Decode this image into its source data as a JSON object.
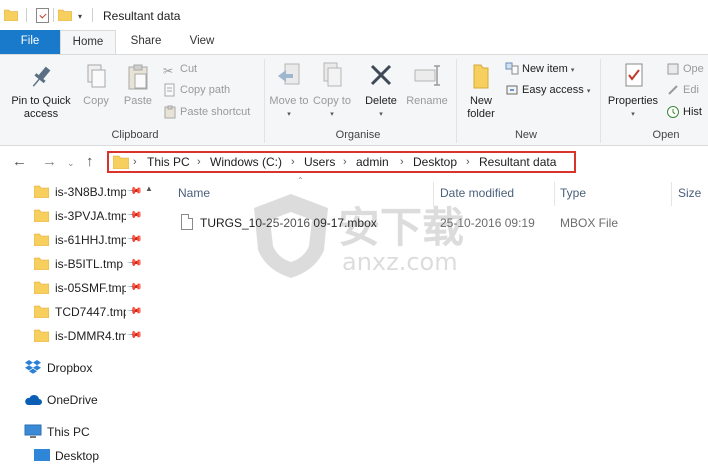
{
  "window": {
    "title": "Resultant data"
  },
  "ribbon_tabs": [
    {
      "label": "File"
    },
    {
      "label": "Home"
    },
    {
      "label": "Share"
    },
    {
      "label": "View"
    }
  ],
  "ribbon": {
    "clipboard": {
      "label": "Clipboard",
      "pin_to_quick_access": "Pin to Quick access",
      "copy": "Copy",
      "paste": "Paste",
      "cut": "Cut",
      "copy_path": "Copy path",
      "paste_shortcut": "Paste shortcut"
    },
    "organise": {
      "label": "Organise",
      "move_to": "Move to",
      "copy_to": "Copy to",
      "delete": "Delete",
      "rename": "Rename"
    },
    "new": {
      "label": "New",
      "new_folder": "New folder",
      "new_item": "New item",
      "easy_access": "Easy access"
    },
    "open": {
      "label": "Open",
      "properties": "Properties",
      "open": "Ope",
      "edit": "Edi",
      "history": "Hist"
    }
  },
  "address_bar": {
    "crumbs": [
      "This PC",
      "Windows (C:)",
      "Users",
      "admin",
      "Desktop",
      "Resultant data"
    ]
  },
  "sidebar": {
    "quick_access_items": [
      {
        "label": "is-3N8BJ.tmp"
      },
      {
        "label": "is-3PVJA.tmp"
      },
      {
        "label": "is-61HHJ.tmp"
      },
      {
        "label": "is-B5ITL.tmp"
      },
      {
        "label": "is-05SMF.tmp"
      },
      {
        "label": "TCD7447.tmp"
      },
      {
        "label": "is-DMMR4.tm"
      }
    ],
    "roots": [
      {
        "label": "Dropbox"
      },
      {
        "label": "OneDrive"
      },
      {
        "label": "This PC"
      },
      {
        "label": "Desktop"
      }
    ]
  },
  "file_list": {
    "columns": {
      "name": "Name",
      "date_modified": "Date modified",
      "type": "Type",
      "size": "Size"
    },
    "rows": [
      {
        "name": "TURGS_10-25-2016 09-17.mbox",
        "date_modified": "25-10-2016 09:19",
        "type": "MBOX File"
      }
    ]
  },
  "watermark": {
    "text_cn": "安下载",
    "text_en": "anxz.com"
  },
  "colors": {
    "file_tab": "#1979ca",
    "address_highlight": "#d9332c",
    "folder_yellow": "#f7cf5e"
  }
}
